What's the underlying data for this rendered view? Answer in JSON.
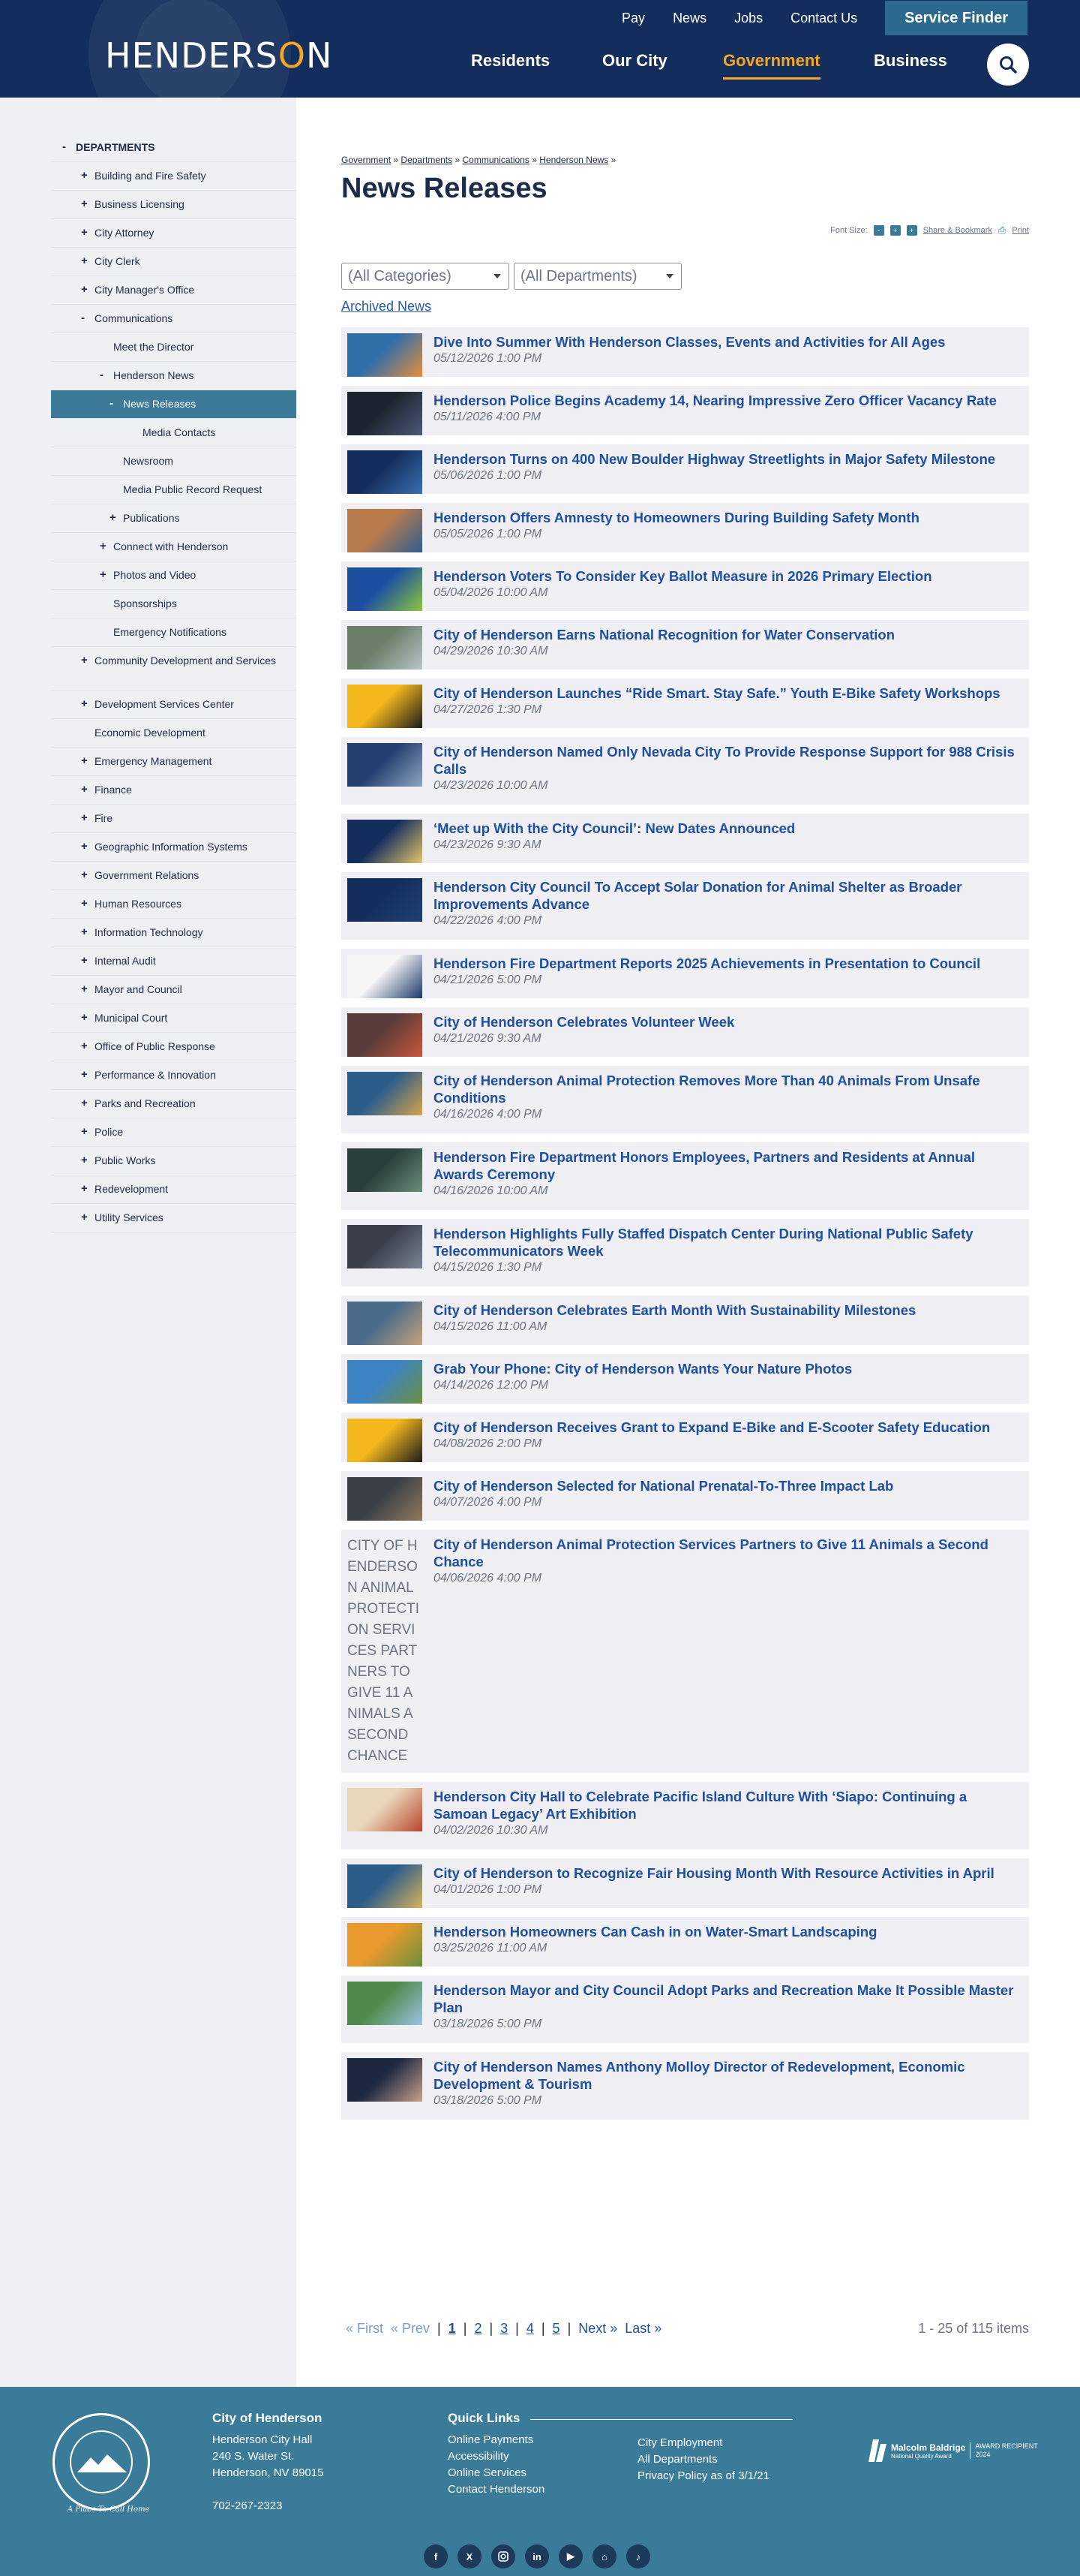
{
  "header": {
    "logo_text": "HENDERSON",
    "utility_links": [
      "Pay",
      "News",
      "Jobs",
      "Contact Us"
    ],
    "service_finder_label": "Service Finder",
    "nav": {
      "residents": "Residents",
      "city": "Our City",
      "government": "Government",
      "business": "Business"
    },
    "accent_color": "#f5a623",
    "brand_color": "#132e5c"
  },
  "sidebar": {
    "items": [
      {
        "label": "DEPARTMENTS",
        "toggle": "-",
        "level": 0
      },
      {
        "label": "Building and Fire Safety",
        "toggle": "+",
        "level": 1
      },
      {
        "label": "Business Licensing",
        "toggle": "+",
        "level": 1
      },
      {
        "label": "City Attorney",
        "toggle": "+",
        "level": 1
      },
      {
        "label": "City Clerk",
        "toggle": "+",
        "level": 1
      },
      {
        "label": "City Manager's Office",
        "toggle": "+",
        "level": 1
      },
      {
        "label": "Communications",
        "toggle": "-",
        "level": 1
      },
      {
        "label": "Meet the Director",
        "toggle": "",
        "level": 2
      },
      {
        "label": "Henderson News",
        "toggle": "-",
        "level": 2
      },
      {
        "label": "News Releases",
        "toggle": "-",
        "level": 3,
        "active": true
      },
      {
        "label": "Media Contacts",
        "toggle": "",
        "level": 4
      },
      {
        "label": "Newsroom",
        "toggle": "",
        "level": 3
      },
      {
        "label": "Media Public Record Request",
        "toggle": "",
        "level": 3
      },
      {
        "label": "Publications",
        "toggle": "+",
        "level": 3
      },
      {
        "label": "Connect with Henderson",
        "toggle": "+",
        "level": 2
      },
      {
        "label": "Photos and Video",
        "toggle": "+",
        "level": 2
      },
      {
        "label": "Sponsorships",
        "toggle": "",
        "level": 2
      },
      {
        "label": "Emergency Notifications",
        "toggle": "",
        "level": 2
      },
      {
        "label": "Community Development and Services",
        "toggle": "+",
        "level": 1,
        "tall": true
      },
      {
        "label": "Development Services Center",
        "toggle": "+",
        "level": 1
      },
      {
        "label": "Economic Development",
        "toggle": "",
        "level": 1
      },
      {
        "label": "Emergency Management",
        "toggle": "+",
        "level": 1
      },
      {
        "label": "Finance",
        "toggle": "+",
        "level": 1
      },
      {
        "label": "Fire",
        "toggle": "+",
        "level": 1
      },
      {
        "label": "Geographic Information Systems",
        "toggle": "+",
        "level": 1
      },
      {
        "label": "Government Relations",
        "toggle": "+",
        "level": 1
      },
      {
        "label": "Human Resources",
        "toggle": "+",
        "level": 1
      },
      {
        "label": "Information Technology",
        "toggle": "+",
        "level": 1
      },
      {
        "label": "Internal Audit",
        "toggle": "+",
        "level": 1
      },
      {
        "label": "Mayor and Council",
        "toggle": "+",
        "level": 1
      },
      {
        "label": "Municipal Court",
        "toggle": "+",
        "level": 1
      },
      {
        "label": "Office of Public Response",
        "toggle": "+",
        "level": 1
      },
      {
        "label": "Performance & Innovation",
        "toggle": "+",
        "level": 1
      },
      {
        "label": "Parks and Recreation",
        "toggle": "+",
        "level": 1
      },
      {
        "label": "Police",
        "toggle": "+",
        "level": 1
      },
      {
        "label": "Public Works",
        "toggle": "+",
        "level": 1
      },
      {
        "label": "Redevelopment",
        "toggle": "+",
        "level": 1
      },
      {
        "label": "Utility Services",
        "toggle": "+",
        "level": 1
      }
    ]
  },
  "main": {
    "breadcrumb": [
      "Government",
      "Departments",
      "Communications",
      "Henderson News"
    ],
    "breadcrumb_sep": "»",
    "title": "News Releases",
    "tools": {
      "font_size_label": "Font Size:",
      "share_label": "Share & Bookmark",
      "print_label": "Print"
    },
    "filters": {
      "categories": "(All Categories)",
      "departments": "(All Departments)"
    },
    "archived_label": "Archived News",
    "news": [
      {
        "title": "Dive Into Summer With Henderson Classes, Events and Activities for All Ages",
        "date": "05/12/2026 1:00 PM",
        "thumb": "summer-classes-thumb",
        "colors": [
          "#2f6fa8",
          "#e88e3c"
        ]
      },
      {
        "title": "Henderson Police Begins Academy 14, Nearing Impressive Zero Officer Vacancy Rate",
        "date": "05/11/2026 4:00 PM",
        "thumb": "police-academy-thumb",
        "colors": [
          "#1d2430",
          "#4a5b78"
        ]
      },
      {
        "title": "Henderson Turns on 400 New Boulder Highway Streetlights in Major Safety Milestone",
        "date": "05/06/2026 1:00 PM",
        "thumb": "streetlights-thumb",
        "colors": [
          "#132e5c",
          "#3a6fb0"
        ]
      },
      {
        "title": "Henderson Offers Amnesty to Homeowners During Building Safety Month",
        "date": "05/05/2026 1:00 PM",
        "thumb": "building-safety-thumb",
        "colors": [
          "#b77b4c",
          "#2f5e91"
        ]
      },
      {
        "title": "Henderson Voters To Consider Key Ballot Measure in 2026 Primary Election",
        "date": "05/04/2026 10:00 AM",
        "thumb": "ballot-measure-thumb",
        "colors": [
          "#1c4fa0",
          "#8dc63f"
        ]
      },
      {
        "title": "City of Henderson Earns National Recognition for Water Conservation",
        "date": "04/29/2026 10:30 AM",
        "thumb": "water-conservation-thumb",
        "colors": [
          "#6b7f6a",
          "#b9c4c9"
        ]
      },
      {
        "title": "City of Henderson Launches “Ride Smart. Stay Safe.” Youth E-Bike Safety Workshops",
        "date": "04/27/2026 1:30 PM",
        "thumb": "ebike-safety-thumb",
        "colors": [
          "#f5b81d",
          "#1c1c1c"
        ]
      },
      {
        "title": "City of Henderson Named Only Nevada City To Provide Response Support for 988 Crisis Calls",
        "date": "04/23/2026 10:00 AM",
        "thumb": "crisis-calls-thumb",
        "colors": [
          "#233f6e",
          "#8fa5c2"
        ]
      },
      {
        "title": "‘Meet up With the City Council’: New Dates Announced",
        "date": "04/23/2026 9:30 AM",
        "thumb": "city-council-thumb",
        "colors": [
          "#132e5c",
          "#e6c46a"
        ]
      },
      {
        "title": "Henderson City Council To Accept Solar Donation for Animal Shelter as Broader Improvements Advance",
        "date": "04/22/2026 4:00 PM",
        "thumb": "henderson-logo-thumb",
        "colors": [
          "#132e5c",
          "#1f3f74"
        ]
      },
      {
        "title": "Henderson Fire Department Reports 2025 Achievements in Presentation to Council",
        "date": "04/21/2026 5:00 PM",
        "thumb": "fire-report-thumb",
        "colors": [
          "#f5f5f5",
          "#1c3a6a"
        ]
      },
      {
        "title": "City of Henderson Celebrates Volunteer Week",
        "date": "04/21/2026 9:30 AM",
        "thumb": "volunteer-week-thumb",
        "colors": [
          "#5a3d3a",
          "#c9563c"
        ]
      },
      {
        "title": "City of Henderson Animal Protection Removes More Than 40 Animals From Unsafe Conditions",
        "date": "04/16/2026 4:00 PM",
        "thumb": "animal-protection-thumb",
        "colors": [
          "#2c5d8a",
          "#d9a24a"
        ]
      },
      {
        "title": "Henderson Fire Department Honors Employees, Partners and Residents at Annual Awards Ceremony",
        "date": "04/16/2026 10:00 AM",
        "thumb": "fire-awards-thumb",
        "colors": [
          "#2a3e3a",
          "#6a8f7a"
        ]
      },
      {
        "title": "Henderson Highlights Fully Staffed Dispatch Center During National Public Safety Telecommunicators Week",
        "date": "04/15/2026 1:30 PM",
        "thumb": "dispatch-center-thumb",
        "colors": [
          "#3a3f4a",
          "#7a8594"
        ]
      },
      {
        "title": "City of Henderson Celebrates Earth Month With Sustainability Milestones",
        "date": "04/15/2026 11:00 AM",
        "thumb": "earth-month-thumb",
        "colors": [
          "#4a6b8a",
          "#c7a27a"
        ]
      },
      {
        "title": "Grab Your Phone: City of Henderson Wants Your Nature Photos",
        "date": "04/14/2026 12:00 PM",
        "thumb": "nature-photos-thumb",
        "colors": [
          "#3d84c6",
          "#6d8f3f"
        ]
      },
      {
        "title": "City of Henderson Receives Grant to Expand E-Bike and E-Scooter Safety Education",
        "date": "04/08/2026 2:00 PM",
        "thumb": "ebike-grant-thumb",
        "colors": [
          "#f5b81d",
          "#1c1c1c"
        ]
      },
      {
        "title": "City of Henderson Selected for National Prenatal-To-Three Impact Lab",
        "date": "04/07/2026 4:00 PM",
        "thumb": "impact-lab-thumb",
        "colors": [
          "#3a3f48",
          "#8f7a5c"
        ]
      },
      {
        "title": "City of Henderson Animal Protection Services Partners to Give 11 Animals a Second Chance",
        "date": "04/06/2026 4:00 PM",
        "thumb": "broken-image",
        "alt": "CITY OF HENDERSON ANIMAL PROTECTION SERVICES PARTNERS TO GIVE 11 ANIMALS A SECOND CHANCE"
      },
      {
        "title": "Henderson City Hall to Celebrate Pacific Island Culture With ‘Siapo: Continuing a Samoan Legacy’ Art Exhibition",
        "date": "04/02/2026 10:30 AM",
        "thumb": "siapo-thumb",
        "colors": [
          "#e8d7b8",
          "#b8442c"
        ]
      },
      {
        "title": "City of Henderson to Recognize Fair Housing Month With Resource Activities in April",
        "date": "04/01/2026 1:00 PM",
        "thumb": "fair-housing-thumb",
        "colors": [
          "#2c5d8a",
          "#d9b25a"
        ]
      },
      {
        "title": "Henderson Homeowners Can Cash in on Water-Smart Landscaping",
        "date": "03/25/2026 11:00 AM",
        "thumb": "landscaping-thumb",
        "colors": [
          "#e89a2c",
          "#6a8f3f"
        ]
      },
      {
        "title": "Henderson Mayor and City Council Adopt Parks and Recreation Make It Possible Master Plan",
        "date": "03/18/2026 5:00 PM",
        "thumb": "parks-plan-thumb",
        "colors": [
          "#4f8a4a",
          "#9bc3e6"
        ]
      },
      {
        "title": "City of Henderson Names Anthony Molloy Director of Redevelopment, Economic Development & Tourism",
        "date": "03/18/2026 5:00 PM",
        "thumb": "director-portrait-thumb",
        "colors": [
          "#1c2740",
          "#c9a08a"
        ]
      }
    ],
    "pagination": {
      "first": "« First",
      "prev": "« Prev",
      "pages": [
        "1",
        "2",
        "3",
        "4",
        "5"
      ],
      "next": "Next »",
      "last": "Last »",
      "count": "1 - 25 of 115 items"
    }
  },
  "footer": {
    "seal_tagline": "A Place To Call Home",
    "city_heading": "City of Henderson",
    "address": [
      "Henderson City Hall",
      "240 S. Water St.",
      "Henderson, NV 89015"
    ],
    "phone": "702-267-2323",
    "quick_links_heading": "Quick Links",
    "links_col1": [
      "Online Payments",
      "Accessibility",
      "Online Services",
      "Contact Henderson"
    ],
    "links_col2": [
      "City Employment",
      "All Departments",
      "Privacy Policy as of 3/1/21"
    ],
    "award": {
      "name": "Malcolm Baldrige",
      "sub": "National Quality Award",
      "rec": "AWARD RECIPIENT",
      "year": "2024"
    },
    "social": [
      "facebook-icon",
      "x-icon",
      "instagram-icon",
      "linkedin-icon",
      "youtube-icon",
      "nextdoor-icon",
      "tiktok-icon"
    ]
  }
}
